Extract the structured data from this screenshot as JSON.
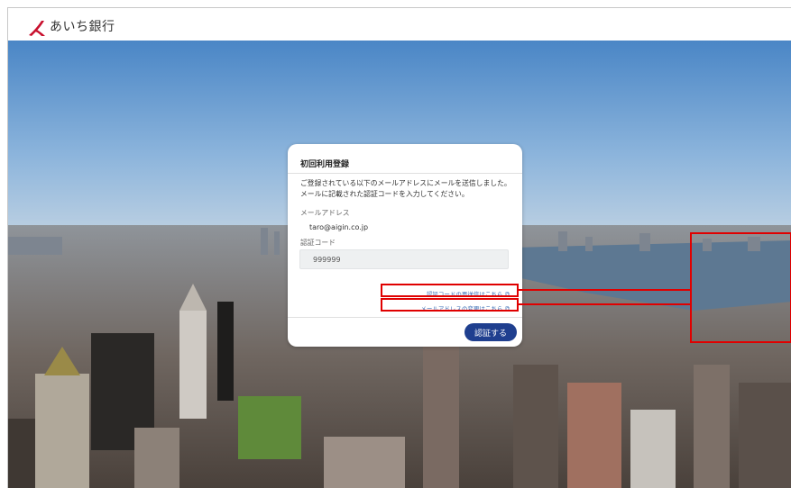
{
  "header": {
    "bank_name": "あいち銀行"
  },
  "dialog": {
    "title": "初回利用登録",
    "description": "ご登録されている以下のメールアドレスにメールを送信しました。メールに記載された認証コードを入力してください。",
    "email_label": "メールアドレス",
    "email_value": "taro@aigin.co.jp",
    "code_label": "認証コード",
    "code_value": "999999",
    "resend_link": "認証コードの再送信はこちら",
    "change_email_link": "メールアドレスの変更はこちら",
    "submit_label": "認証する"
  },
  "colors": {
    "brand": "#c8102e",
    "link": "#3a6db5",
    "button": "#1f3f8f",
    "highlight": "#e00000"
  },
  "icons": {
    "brand_logo": "aichi-bank-logo",
    "external_link": "external-link-icon"
  }
}
